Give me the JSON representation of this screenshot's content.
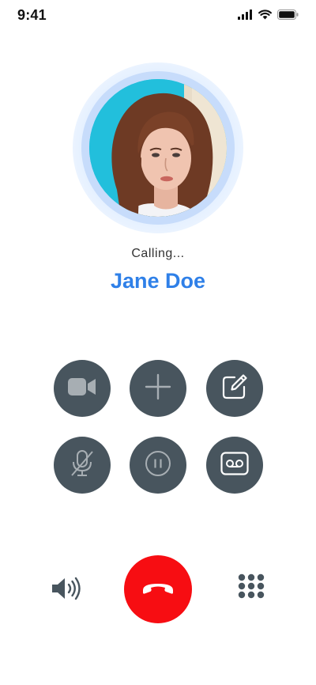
{
  "status_bar": {
    "time": "9:41",
    "icons": [
      "signal-icon",
      "wifi-icon",
      "battery-icon"
    ]
  },
  "call": {
    "status": "Calling...",
    "caller_name": "Jane Doe"
  },
  "controls": {
    "row1": [
      "video-icon",
      "add-call-icon",
      "edit-icon"
    ],
    "row2": [
      "mute-icon",
      "hold-icon",
      "voicemail-icon"
    ]
  },
  "bottom": {
    "left": "speaker-icon",
    "center": "end-call-icon",
    "right": "keypad-icon"
  },
  "colors": {
    "accent": "#2f80e8",
    "button": "#48555e",
    "end_call": "#f70d12",
    "avatar_ring": "#c7dcfb",
    "icon_light": "#a7aeb3"
  }
}
